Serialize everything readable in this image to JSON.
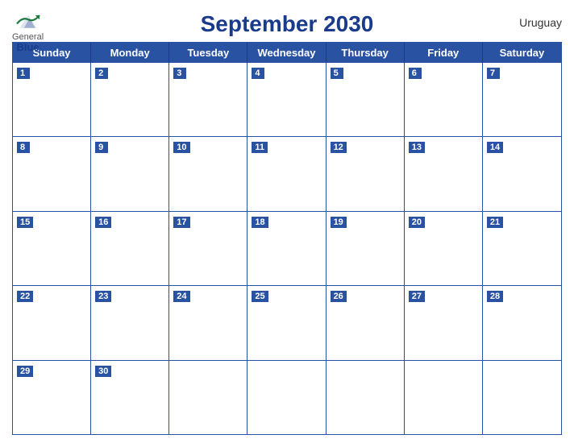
{
  "header": {
    "title": "September 2030",
    "country": "Uruguay",
    "logo_general": "General",
    "logo_blue": "Blue"
  },
  "days_of_week": [
    "Sunday",
    "Monday",
    "Tuesday",
    "Wednesday",
    "Thursday",
    "Friday",
    "Saturday"
  ],
  "weeks": [
    [
      {
        "num": "1",
        "active": true
      },
      {
        "num": "2",
        "active": true
      },
      {
        "num": "3",
        "active": true
      },
      {
        "num": "4",
        "active": true
      },
      {
        "num": "5",
        "active": true
      },
      {
        "num": "6",
        "active": true
      },
      {
        "num": "7",
        "active": true
      }
    ],
    [
      {
        "num": "8",
        "active": true
      },
      {
        "num": "9",
        "active": true
      },
      {
        "num": "10",
        "active": true
      },
      {
        "num": "11",
        "active": true
      },
      {
        "num": "12",
        "active": true
      },
      {
        "num": "13",
        "active": true
      },
      {
        "num": "14",
        "active": true
      }
    ],
    [
      {
        "num": "15",
        "active": true
      },
      {
        "num": "16",
        "active": true
      },
      {
        "num": "17",
        "active": true
      },
      {
        "num": "18",
        "active": true
      },
      {
        "num": "19",
        "active": true
      },
      {
        "num": "20",
        "active": true
      },
      {
        "num": "21",
        "active": true
      }
    ],
    [
      {
        "num": "22",
        "active": true
      },
      {
        "num": "23",
        "active": true
      },
      {
        "num": "24",
        "active": true
      },
      {
        "num": "25",
        "active": true
      },
      {
        "num": "26",
        "active": true
      },
      {
        "num": "27",
        "active": true
      },
      {
        "num": "28",
        "active": true
      }
    ],
    [
      {
        "num": "29",
        "active": true
      },
      {
        "num": "30",
        "active": true
      },
      {
        "num": "",
        "active": false
      },
      {
        "num": "",
        "active": false
      },
      {
        "num": "",
        "active": false
      },
      {
        "num": "",
        "active": false
      },
      {
        "num": "",
        "active": false
      }
    ]
  ]
}
